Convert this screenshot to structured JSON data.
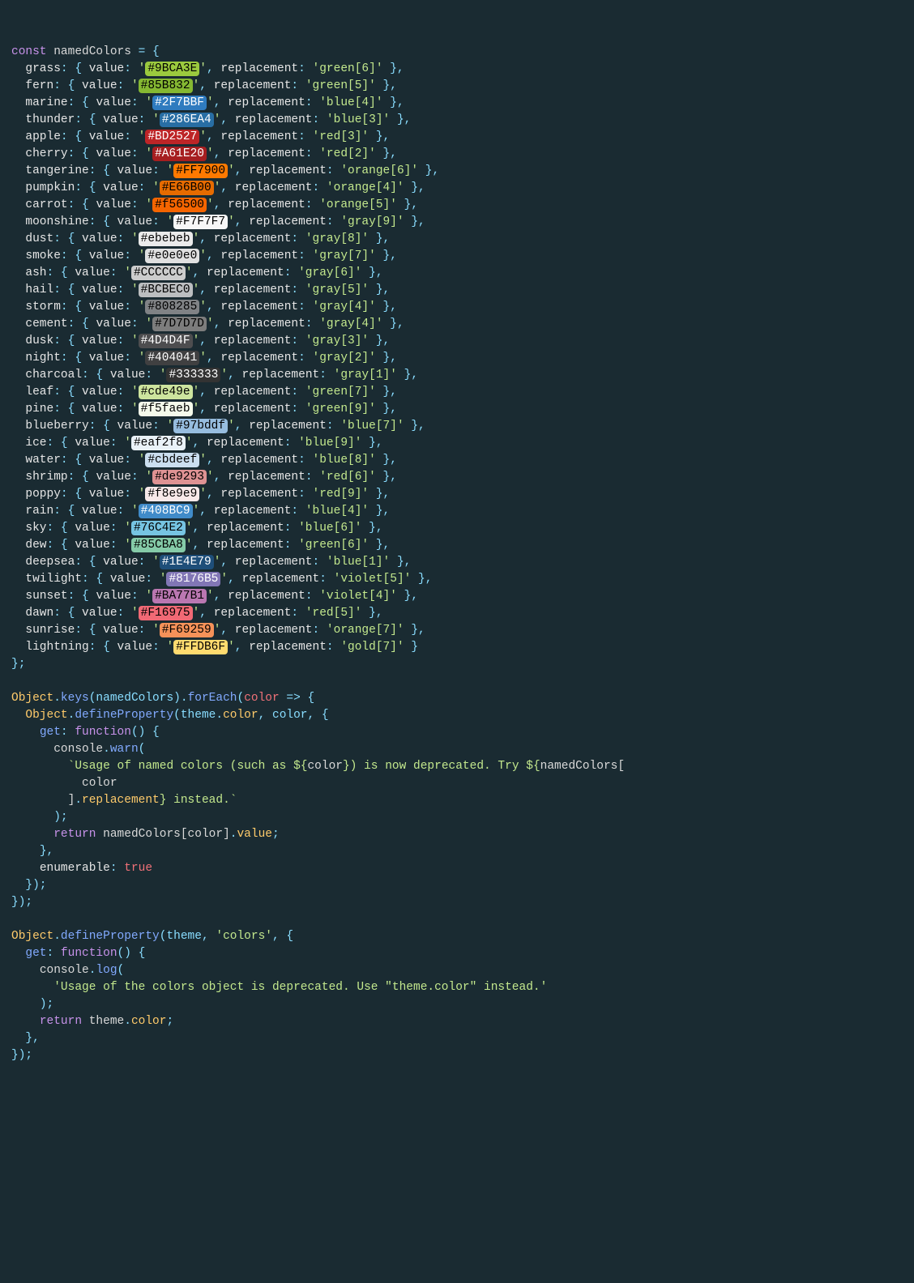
{
  "header": {
    "const": "const",
    "varName": "namedColors",
    "assign": " = {"
  },
  "colors": [
    {
      "name": "grass",
      "hex": "#9BCA3E",
      "bg": "#9BCA3E",
      "fg": "#000",
      "replacement": "green[6]"
    },
    {
      "name": "fern",
      "hex": "#85B832",
      "bg": "#85B832",
      "fg": "#000",
      "replacement": "green[5]"
    },
    {
      "name": "marine",
      "hex": "#2F7BBF",
      "bg": "#2F7BBF",
      "fg": "#fff",
      "replacement": "blue[4]"
    },
    {
      "name": "thunder",
      "hex": "#286EA4",
      "bg": "#286EA4",
      "fg": "#fff",
      "replacement": "blue[3]"
    },
    {
      "name": "apple",
      "hex": "#BD2527",
      "bg": "#BD2527",
      "fg": "#fff",
      "replacement": "red[3]"
    },
    {
      "name": "cherry",
      "hex": "#A61E20",
      "bg": "#A61E20",
      "fg": "#fff",
      "replacement": "red[2]"
    },
    {
      "name": "tangerine",
      "hex": "#FF7900",
      "bg": "#FF7900",
      "fg": "#000",
      "replacement": "orange[6]"
    },
    {
      "name": "pumpkin",
      "hex": "#E66B00",
      "bg": "#E66B00",
      "fg": "#000",
      "replacement": "orange[4]"
    },
    {
      "name": "carrot",
      "hex": "#f56500",
      "bg": "#f56500",
      "fg": "#000",
      "replacement": "orange[5]"
    },
    {
      "name": "moonshine",
      "hex": "#F7F7F7",
      "bg": "#F7F7F7",
      "fg": "#000",
      "replacement": "gray[9]"
    },
    {
      "name": "dust",
      "hex": "#ebebeb",
      "bg": "#ebebeb",
      "fg": "#000",
      "replacement": "gray[8]"
    },
    {
      "name": "smoke",
      "hex": "#e0e0e0",
      "bg": "#e0e0e0",
      "fg": "#000",
      "replacement": "gray[7]"
    },
    {
      "name": "ash",
      "hex": "#CCCCCC",
      "bg": "#CCCCCC",
      "fg": "#000",
      "replacement": "gray[6]"
    },
    {
      "name": "hail",
      "hex": "#BCBEC0",
      "bg": "#BCBEC0",
      "fg": "#000",
      "replacement": "gray[5]"
    },
    {
      "name": "storm",
      "hex": "#808285",
      "bg": "#808285",
      "fg": "#000",
      "replacement": "gray[4]"
    },
    {
      "name": "cement",
      "hex": "#7D7D7D",
      "bg": "#7D7D7D",
      "fg": "#000",
      "replacement": "gray[4]"
    },
    {
      "name": "dusk",
      "hex": "#4D4D4F",
      "bg": "#4D4D4F",
      "fg": "#fff",
      "replacement": "gray[3]"
    },
    {
      "name": "night",
      "hex": "#404041",
      "bg": "#404041",
      "fg": "#fff",
      "replacement": "gray[2]"
    },
    {
      "name": "charcoal",
      "hex": "#333333",
      "bg": "#333333",
      "fg": "#fff",
      "replacement": "gray[1]"
    },
    {
      "name": "leaf",
      "hex": "#cde49e",
      "bg": "#cde49e",
      "fg": "#000",
      "replacement": "green[7]"
    },
    {
      "name": "pine",
      "hex": "#f5faeb",
      "bg": "#f5faeb",
      "fg": "#000",
      "replacement": "green[9]"
    },
    {
      "name": "blueberry",
      "hex": "#97bddf",
      "bg": "#97bddf",
      "fg": "#000",
      "replacement": "blue[7]"
    },
    {
      "name": "ice",
      "hex": "#eaf2f8",
      "bg": "#eaf2f8",
      "fg": "#000",
      "replacement": "blue[9]"
    },
    {
      "name": "water",
      "hex": "#cbdeef",
      "bg": "#cbdeef",
      "fg": "#000",
      "replacement": "blue[8]"
    },
    {
      "name": "shrimp",
      "hex": "#de9293",
      "bg": "#de9293",
      "fg": "#000",
      "replacement": "red[6]"
    },
    {
      "name": "poppy",
      "hex": "#f8e9e9",
      "bg": "#f8e9e9",
      "fg": "#000",
      "replacement": "red[9]"
    },
    {
      "name": "rain",
      "hex": "#408BC9",
      "bg": "#408BC9",
      "fg": "#fff",
      "replacement": "blue[4]"
    },
    {
      "name": "sky",
      "hex": "#76C4E2",
      "bg": "#76C4E2",
      "fg": "#000",
      "replacement": "blue[6]"
    },
    {
      "name": "dew",
      "hex": "#85CBA8",
      "bg": "#85CBA8",
      "fg": "#000",
      "replacement": "green[6]"
    },
    {
      "name": "deepsea",
      "hex": "#1E4E79",
      "bg": "#1E4E79",
      "fg": "#fff",
      "replacement": "blue[1]"
    },
    {
      "name": "twilight",
      "hex": "#8176B5",
      "bg": "#8176B5",
      "fg": "#fff",
      "replacement": "violet[5]"
    },
    {
      "name": "sunset",
      "hex": "#BA77B1",
      "bg": "#BA77B1",
      "fg": "#000",
      "replacement": "violet[4]"
    },
    {
      "name": "dawn",
      "hex": "#F16975",
      "bg": "#F16975",
      "fg": "#000",
      "replacement": "red[5]"
    },
    {
      "name": "sunrise",
      "hex": "#F69259",
      "bg": "#F69259",
      "fg": "#000",
      "replacement": "orange[7]"
    },
    {
      "name": "lightning",
      "hex": "#FFDB6F",
      "bg": "#FFDB6F",
      "fg": "#000",
      "replacement": "gold[7]"
    }
  ],
  "footer": {
    "close": "};",
    "block2": {
      "l1a": "Object",
      "l1b": ".",
      "l1c": "keys",
      "l1d": "(namedColors)",
      "l1e": ".",
      "l1f": "forEach",
      "l1g": "(",
      "l1h": "color",
      "l1i": " => {",
      "l2a": "Object",
      "l2b": ".",
      "l2c": "defineProperty",
      "l2d": "(theme",
      "l2e": ".",
      "l2f": "color",
      "l2g": ", color, {",
      "l3a": "get",
      "l3b": ": ",
      "l3c": "function",
      "l3d": "() {",
      "l4a": "console",
      "l4b": ".",
      "l4c": "warn",
      "l4d": "(",
      "l5": "`Usage of named colors (such as ${",
      "l5b": "color",
      "l5c": "}) is now deprecated. Try ${",
      "l5d": "namedColors[",
      "l6": "color",
      "l7a": "]",
      "l7b": ".",
      "l7c": "replacement",
      "l7d": "} instead.`",
      "l8": ");",
      "l9a": "return",
      "l9b": " namedColors[color]",
      "l9c": ".",
      "l9d": "value",
      "l9e": ";",
      "l10": "},",
      "l11a": "enumerable",
      "l11b": ": ",
      "l11c": "true",
      "l12": "});",
      "l13": "});"
    },
    "block3": {
      "l1a": "Object",
      "l1b": ".",
      "l1c": "defineProperty",
      "l1d": "(theme, ",
      "l1e": "'colors'",
      "l1f": ", {",
      "l2a": "get",
      "l2b": ": ",
      "l2c": "function",
      "l2d": "() {",
      "l3a": "console",
      "l3b": ".",
      "l3c": "log",
      "l3d": "(",
      "l4": "'Usage of the colors object is deprecated. Use \"theme.color\" instead.'",
      "l5": ");",
      "l6a": "return",
      "l6b": " theme",
      "l6c": ".",
      "l6d": "color",
      "l6e": ";",
      "l7": "},",
      "l8": "});"
    }
  }
}
